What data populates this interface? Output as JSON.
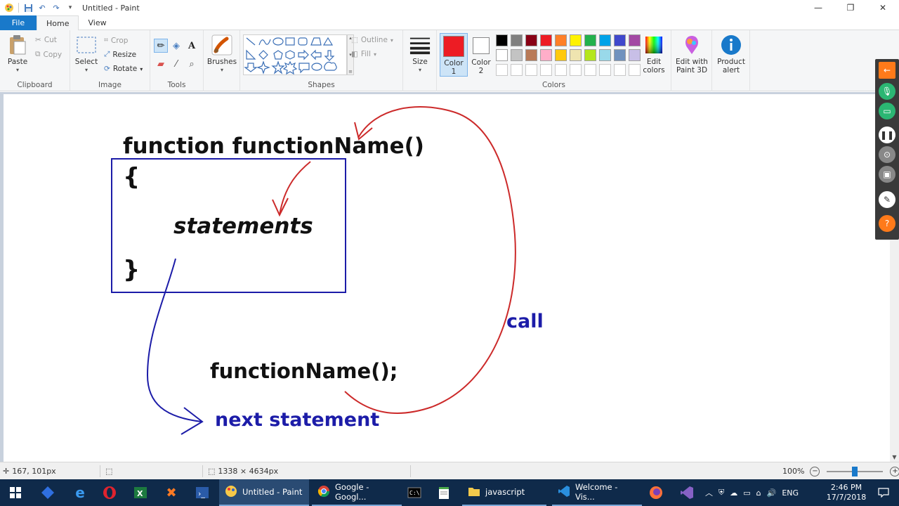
{
  "window": {
    "title": "Untitled - Paint",
    "controls": [
      "—",
      "❐",
      "✕"
    ]
  },
  "tabs": {
    "file": "File",
    "home": "Home",
    "view": "View"
  },
  "ribbon": {
    "clipboard": {
      "label": "Clipboard",
      "paste": "Paste",
      "cut": "Cut",
      "copy": "Copy"
    },
    "image": {
      "label": "Image",
      "select": "Select",
      "crop": "Crop",
      "resize": "Resize",
      "rotate": "Rotate"
    },
    "tools": {
      "label": "Tools"
    },
    "brushes": {
      "label": "Brushes"
    },
    "shapes": {
      "label": "Shapes",
      "outline": "Outline",
      "fill": "Fill"
    },
    "size": {
      "label": "Size"
    },
    "colors": {
      "label": "Colors",
      "color1": "Color 1",
      "color1_line1": "Color",
      "color1_line2": "1",
      "color2_line1": "Color",
      "color2_line2": "2",
      "color1_value": "#ed1c24",
      "color2_value": "#ffffff",
      "palette_row1": [
        "#000000",
        "#7f7f7f",
        "#880015",
        "#ed1c24",
        "#ff7f27",
        "#fff200",
        "#22b14c",
        "#00a2e8",
        "#3f48cc",
        "#a349a4"
      ],
      "palette_row2": [
        "#ffffff",
        "#c3c3c3",
        "#b97a57",
        "#ffaec9",
        "#ffc90e",
        "#efe4b0",
        "#b5e61d",
        "#99d9ea",
        "#7092be",
        "#c8bfe7"
      ],
      "edit_line1": "Edit",
      "edit_line2": "colors"
    },
    "paint3d": {
      "line1": "Edit with",
      "line2": "Paint 3D"
    },
    "product_alert": {
      "line1": "Product",
      "line2": "alert"
    }
  },
  "canvas": {
    "func_decl": "function functionName()",
    "open_brace": "{",
    "statements": "statements",
    "close_brace": "}",
    "call_stmt": "functionName();",
    "call_label": "call",
    "next_statement": "next statement"
  },
  "status": {
    "cursor_pos": "167, 101px",
    "image_size": "1338 × 4634px",
    "zoom": "100%",
    "zoom_fraction": 0.5
  },
  "taskbar": {
    "apps": {
      "paint": "Untitled - Paint",
      "chrome": "Google - Googl...",
      "javascript": "javascript",
      "vscode": "Welcome - Vis..."
    },
    "lang": "ENG",
    "time": "2:46 PM",
    "date": "17/7/2018"
  }
}
